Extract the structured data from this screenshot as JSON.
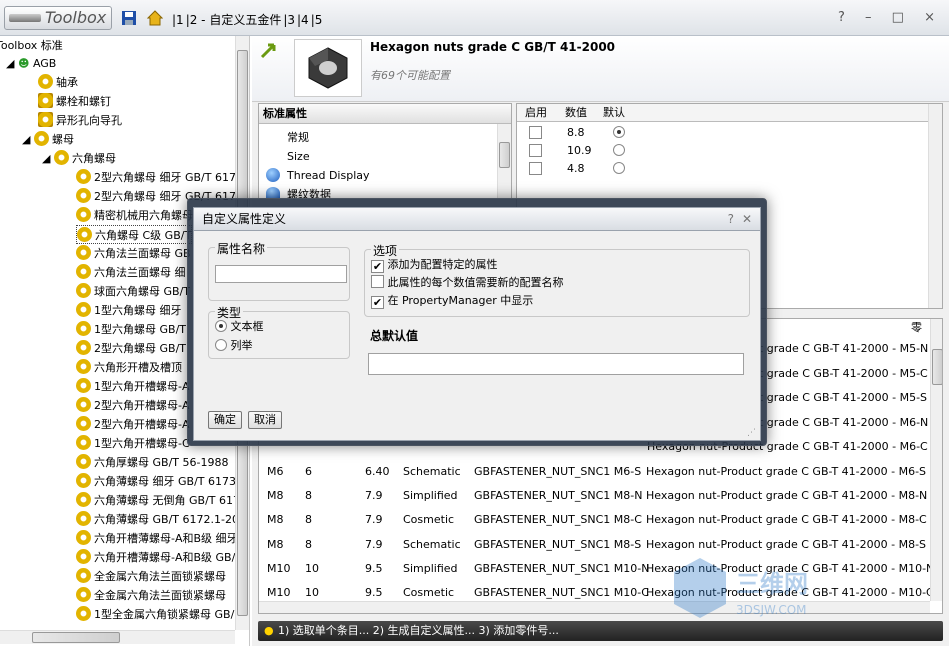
{
  "toolbar": {
    "logo": "Toolbox",
    "tabs": [
      "|1",
      "|2 - 自定义五金件",
      "|3",
      "|4",
      "|5"
    ],
    "win_buttons": "? – □ ×"
  },
  "tree": {
    "root": "Toolbox 标准",
    "standard": "AGB",
    "categories": [
      "轴承",
      "螺栓和螺钉",
      "异形孔向导孔",
      "螺母"
    ],
    "subcategory": "六角螺母",
    "items": [
      "2型六角螺母 细牙 GB/T 617",
      "2型六角螺母 细牙 GB/T 617",
      "精密机械用六角螺母",
      "六角螺母 C级 GB/T",
      "六角法兰面螺母 GB",
      "六角法兰面螺母 细",
      "球面六角螺母 GB/T",
      "1型六角螺母 细牙",
      "1型六角螺母 GB/T",
      "2型六角螺母 GB/T",
      "六角形开槽及槽顶",
      "1型六角开槽螺母-A",
      "2型六角开槽螺母-A",
      "2型六角开槽螺母-A",
      "1型六角开槽螺母-C",
      "六角厚螺母 GB/T 56-1988",
      "六角薄螺母 细牙 GB/T 6173",
      "六角薄螺母 无倒角 GB/T 617",
      "六角薄螺母 GB/T 6172.1-20",
      "六角开槽薄螺母-A和B级 细牙",
      "六角开槽薄螺母-A和B级 GB/",
      "全金属六角法兰面锁紧螺母",
      "全金属六角法兰面锁紧螺母",
      "1型全金属六角锁紧螺母 GB/"
    ]
  },
  "part": {
    "title": "Hexagon nuts grade C GB/T 41-2000",
    "subtitle": "有69个可能配置"
  },
  "props": {
    "header": "标准属性",
    "items": [
      "常规",
      "Size",
      "Thread Display",
      "螺纹数据"
    ]
  },
  "values": {
    "headers": [
      "启用",
      "数值",
      "默认"
    ],
    "rows": [
      {
        "value": "8.8",
        "default": true
      },
      {
        "value": "10.9",
        "default": false
      },
      {
        "value": "4.8",
        "default": false
      }
    ]
  },
  "table": {
    "header_right": "零",
    "rows_top": [
      "Hexagon nut-Product grade C GB-T 41-2000 - M5-N",
      "Hexagon nut-Product grade C GB-T 41-2000 - M5-C",
      "Hexagon nut-Product grade C GB-T 41-2000 - M5-S",
      "Hexagon nut-Product grade C GB-T 41-2000 - M6-N",
      "Hexagon nut-Product grade C GB-T 41-2000 - M6-C"
    ],
    "rows": [
      [
        "M6",
        "6",
        "6.40",
        "Schematic",
        "GBFASTENER_NUT_SNC1 M6-S",
        "Hexagon nut-Product grade C GB-T 41-2000 - M6-S"
      ],
      [
        "M8",
        "8",
        "7.9",
        "Simplified",
        "GBFASTENER_NUT_SNC1 M8-N",
        "Hexagon nut-Product grade C GB-T 41-2000 - M8-N"
      ],
      [
        "M8",
        "8",
        "7.9",
        "Cosmetic",
        "GBFASTENER_NUT_SNC1 M8-C",
        "Hexagon nut-Product grade C GB-T 41-2000 - M8-C"
      ],
      [
        "M8",
        "8",
        "7.9",
        "Schematic",
        "GBFASTENER_NUT_SNC1 M8-S",
        "Hexagon nut-Product grade C GB-T 41-2000 - M8-S"
      ],
      [
        "M10",
        "10",
        "9.5",
        "Simplified",
        "GBFASTENER_NUT_SNC1 M10-N",
        "Hexagon nut-Product grade C GB-T 41-2000 - M10-N"
      ],
      [
        "M10",
        "10",
        "9.5",
        "Cosmetic",
        "GBFASTENER_NUT_SNC1 M10-C",
        "Hexagon nut-Product grade C GB-T 41-2000 - M10-C"
      ]
    ]
  },
  "status": "1) 选取单个条目... 2) 生成自定义属性... 3) 添加零件号...",
  "dialog": {
    "title": "自定义属性定义",
    "name_label": "属性名称",
    "name_value": "",
    "type_label": "类型",
    "type_options": [
      "文本框",
      "列举"
    ],
    "options_label": "选项",
    "options": [
      {
        "label": "添加为配置特定的属性",
        "checked": true
      },
      {
        "label": "此属性的每个数值需要新的配置名称",
        "checked": false
      },
      {
        "label": "在 PropertyManager 中显示",
        "checked": true
      }
    ],
    "default_label": "总默认值",
    "default_value": "",
    "ok": "确定",
    "cancel": "取消"
  },
  "watermark": "3DSJW.COM"
}
